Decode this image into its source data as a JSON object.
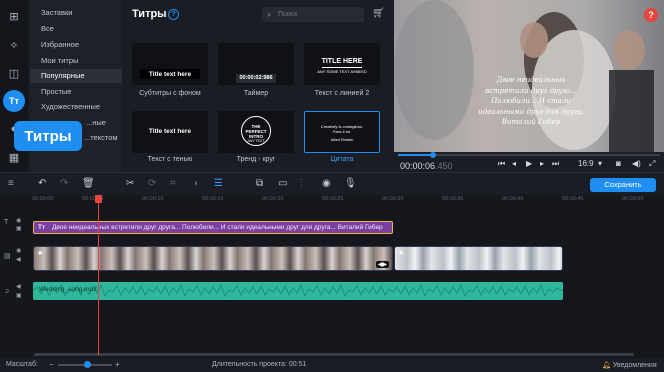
{
  "sidebar": {
    "callout_label": "Титры",
    "active_icon_text": "Тт",
    "categories": [
      "Заставки",
      "Все",
      "Избранное",
      "Мои титры",
      "Популярные",
      "Простые",
      "Художественные",
      "...ные",
      "...текстом"
    ]
  },
  "panel": {
    "title": "Титры",
    "help": "?",
    "search_placeholder": "Поиск",
    "items": [
      {
        "label": "Субтитры с фоном",
        "preview_text": "Title text here"
      },
      {
        "label": "Таймер",
        "preview_text": "00:00:02:986"
      },
      {
        "label": "Текст с линией 2",
        "preview_text": "TITLE HERE",
        "preview_sub": "ANY SOME TEXT ASNEED"
      },
      {
        "label": "Текст с тенью",
        "preview_text": "Title text here"
      },
      {
        "label": "Тренд - круг",
        "preview_text": "THE PERFECT INTRO",
        "preview_sub": "ANY TEXT"
      },
      {
        "label": "Цитата",
        "preview_text": "Creativity is contagious. Pass it on.",
        "preview_sub": "Albert Einstein"
      }
    ]
  },
  "preview": {
    "quote_lines": [
      "Двое неидеальных",
      "встретили друг друга...",
      "Полюбили... И стали",
      "идеальными друг для друга.",
      "Виталий Гибер"
    ],
    "help": "?"
  },
  "player": {
    "time_main": "00:00:06",
    "time_ms": ".450",
    "aspect": "16:9"
  },
  "toolbar": {
    "save_label": "Сохранить"
  },
  "timeline": {
    "ruler_labels": [
      "00:00:00",
      "00:00:05",
      "00:00:10",
      "00:00:15",
      "00:00:20",
      "00:00:25",
      "00:00:30",
      "00:00:35",
      "00:00:40",
      "00:00:45",
      "00:00:50",
      "00:00:55",
      "00:01:00"
    ],
    "title_clip_text": "Двое неидеальных встретили друг друга... Полюбили... И стали идеальными друг для друга... Виталий Гибер",
    "audio_clip_label": "Wedding_song.mp3"
  },
  "status": {
    "zoom_label": "Масштаб:",
    "duration_label": "Длительность проекта:",
    "duration_value": "00:51",
    "notifications": "Уведомления"
  },
  "colors": {
    "accent": "#1e8ef2",
    "title_clip": "#7b3fa0",
    "audio_clip": "#2fb89c",
    "playhead": "#e8453c"
  }
}
